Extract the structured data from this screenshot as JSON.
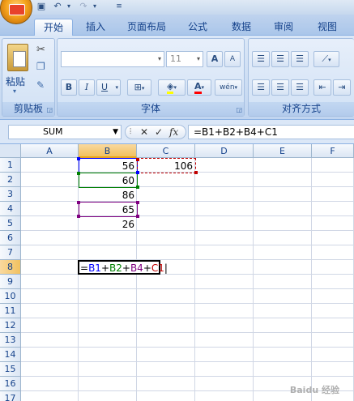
{
  "tabs": [
    "开始",
    "插入",
    "页面布局",
    "公式",
    "数据",
    "审阅",
    "视图"
  ],
  "active_tab": "开始",
  "ribbon": {
    "clipboard_label": "剪贴板",
    "paste_label": "粘贴",
    "font_label": "字体",
    "font_size": "11",
    "align_label": "对齐方式",
    "bold": "B",
    "italic": "I",
    "underline": "U",
    "font_color": "A",
    "grow": "A",
    "shrink": "A",
    "phonetic": "wén"
  },
  "formula_bar": {
    "name_box": "SUM",
    "cancel": "✕",
    "enter": "✓",
    "fx": "fx",
    "formula": "=B1+B2+B4+C1"
  },
  "columns": [
    "A",
    "B",
    "C",
    "D",
    "E",
    "F"
  ],
  "rows": [
    "1",
    "2",
    "3",
    "4",
    "5",
    "6",
    "7",
    "8",
    "9",
    "10",
    "11",
    "12",
    "13",
    "14",
    "15",
    "16",
    "17"
  ],
  "cells": {
    "B1": "56",
    "B2": "60",
    "B3": "86",
    "B4": "65",
    "B5": "26",
    "C1": "106"
  },
  "edit_cell": {
    "eq": "=",
    "b1": "B1",
    "p1": "+",
    "b2": "B2",
    "p2": "+",
    "b4": "B4",
    "p3": "+",
    "c1": "C1"
  },
  "watermark": "Baidu 经验",
  "colors": {
    "ref_b1": "#0000ff",
    "ref_b2": "#008000",
    "ref_b4": "#800080",
    "ref_c1": "#c00000"
  }
}
